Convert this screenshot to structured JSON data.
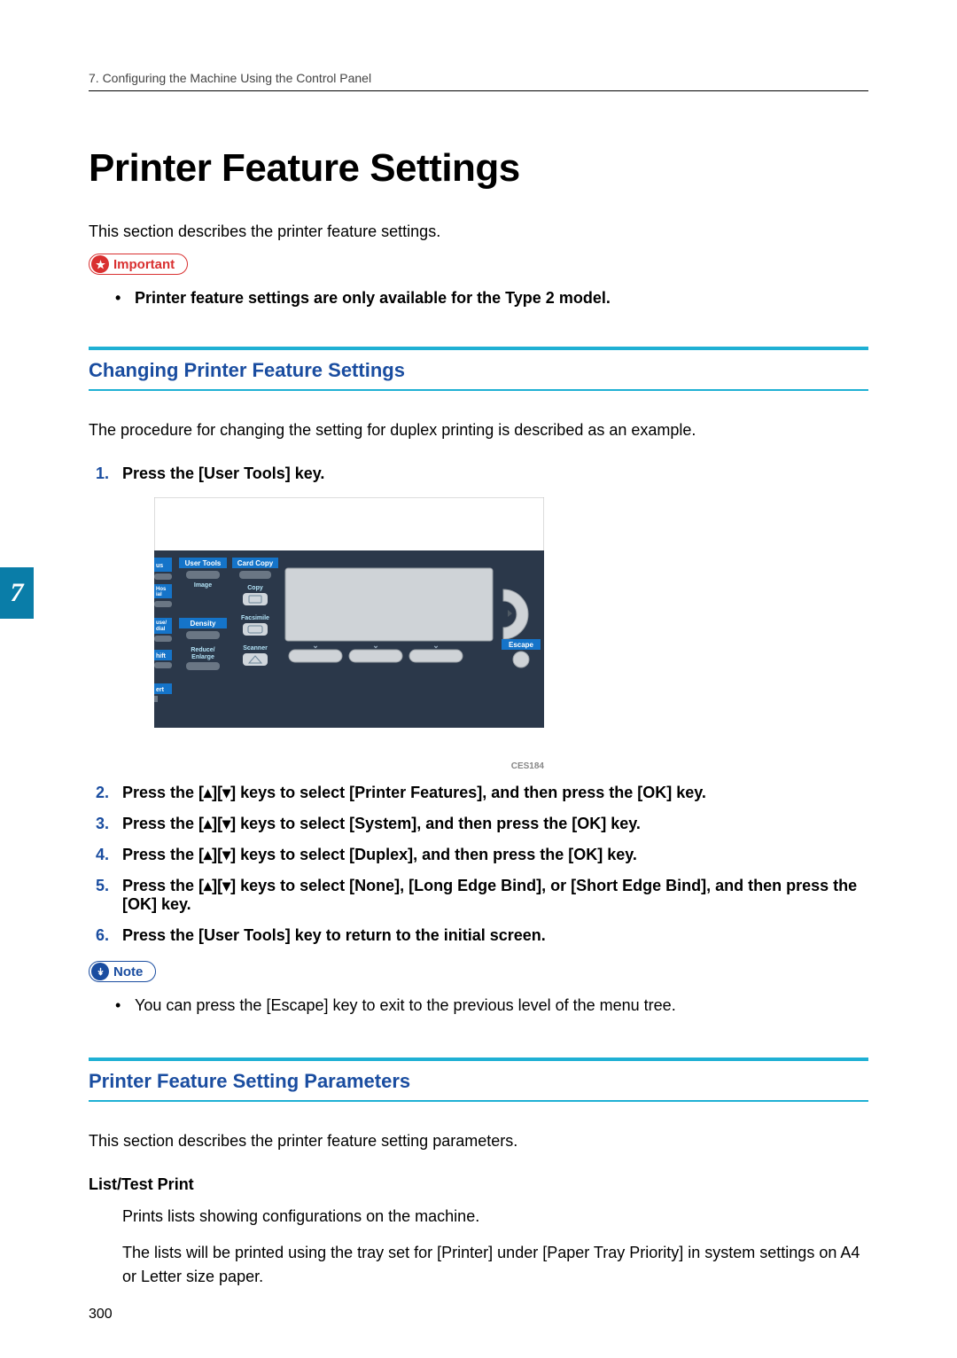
{
  "header": {
    "chapter_line": "7. Configuring the Machine Using the Control Panel"
  },
  "title": "Printer Feature Settings",
  "intro": "This section describes the printer feature settings.",
  "important": {
    "label": "Important",
    "bullets": [
      "Printer feature settings are only available for the Type 2 model."
    ]
  },
  "section1": {
    "heading": "Changing Printer Feature Settings",
    "body": "The procedure for changing the setting for duplex printing is described as an example."
  },
  "steps": [
    "Press the [User Tools] key.",
    "Press the [▴][▾] keys to select [Printer Features], and then press the [OK] key.",
    "Press the [▴][▾] keys to select [System], and then press the [OK] key.",
    "Press the [▴][▾] keys to select [Duplex], and then press the [OK] key.",
    "Press the [▴][▾] keys to select [None], [Long Edge Bind], or [Short Edge Bind], and then press the [OK] key.",
    "Press the [User Tools] key to return to the initial screen."
  ],
  "figure": {
    "label": "CES184",
    "panel_labels": {
      "user_tools": "User Tools",
      "card_copy": "Card Copy",
      "image": "Image",
      "copy": "Copy",
      "density": "Density",
      "facsimile": "Facsimile",
      "reduce_enlarge": "Reduce/\nEnlarge",
      "scanner": "Scanner",
      "escape": "Escape",
      "hift": "hift",
      "ert": "ert",
      "use_dial": "use/\ndial",
      "hos_ial": "Hos\nial",
      "us": "us"
    }
  },
  "note": {
    "label": "Note",
    "bullets": [
      "You can press the [Escape] key to exit to the previous level of the menu tree."
    ]
  },
  "section2": {
    "heading": "Printer Feature Setting Parameters",
    "body": "This section describes the printer feature setting parameters.",
    "param_term": "List/Test Print",
    "param_desc1": "Prints lists showing configurations on the machine.",
    "param_desc2": "The lists will be printed using the tray set for [Printer] under [Paper Tray Priority] in system settings on A4 or Letter size paper."
  },
  "chapter_tab": "7",
  "page_number": "300"
}
